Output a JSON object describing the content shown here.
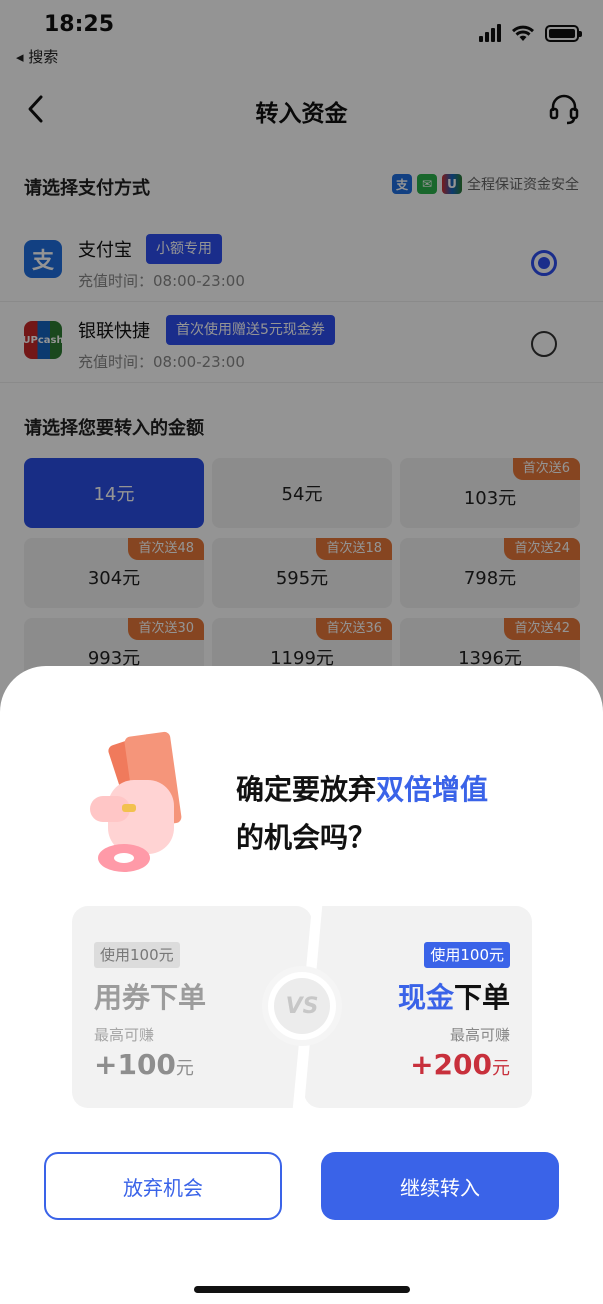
{
  "status_bar": {
    "time": "18:25",
    "back_label": "◂ 搜索"
  },
  "nav": {
    "title": "转入资金"
  },
  "payment": {
    "section_title": "请选择支付方式",
    "secure_text": "全程保证资金安全",
    "methods": [
      {
        "name": "支付宝",
        "tag": "小额专用",
        "time": "充值时间：08:00-23:00",
        "selected": true
      },
      {
        "name": "银联快捷",
        "tag": "首次使用赠送5元现金券",
        "time": "充值时间：08:00-23:00",
        "selected": false
      }
    ]
  },
  "amount": {
    "section_title": "请选择您要转入的金额",
    "options": [
      {
        "label": "14元",
        "bonus": "",
        "selected": true
      },
      {
        "label": "54元",
        "bonus": ""
      },
      {
        "label": "103元",
        "bonus": "首次送6"
      },
      {
        "label": "304元",
        "bonus": "首次送48"
      },
      {
        "label": "595元",
        "bonus": "首次送18"
      },
      {
        "label": "798元",
        "bonus": "首次送24"
      },
      {
        "label": "993元",
        "bonus": "首次送30"
      },
      {
        "label": "1199元",
        "bonus": "首次送36"
      },
      {
        "label": "1396元",
        "bonus": "首次送42"
      }
    ]
  },
  "dialog": {
    "headline_prefix": "确定要放弃",
    "headline_highlight": "双倍增值",
    "headline_suffix": "的机会吗？",
    "left": {
      "tag": "使用100元",
      "method": "用券下单",
      "earn_label": "最高可赚",
      "earn_value": "+100",
      "earn_unit": "元"
    },
    "vs": "VS",
    "right": {
      "tag": "使用100元",
      "method_highlight": "现金",
      "method_rest": "下单",
      "earn_label": "最高可赚",
      "earn_value": "+200",
      "earn_unit": "元"
    },
    "giveup_label": "放弃机会",
    "continue_label": "继续转入"
  },
  "colors": {
    "accent": "#3a63e8",
    "bonus": "#e7783a",
    "earn_red": "#c8303c"
  }
}
